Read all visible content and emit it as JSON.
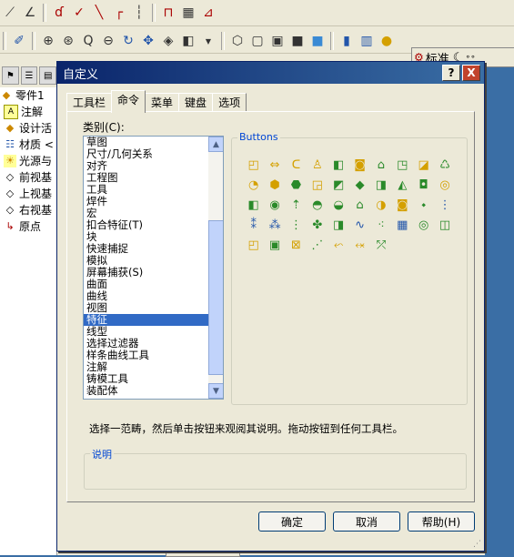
{
  "toolbar_row1": {
    "icons": [
      "sketch-tool",
      "line-tool",
      "arc-tool",
      "check-tool",
      "slash-tool",
      "corner-tool",
      "dashed-corner-tool",
      "dimension-tool",
      "grid-tool",
      "angle-tool"
    ]
  },
  "toolbar_row2": {
    "icons": [
      "pointer-tool",
      "zoom-tool",
      "zoom-fit-tool",
      "zoom-query-tool",
      "zoom-out-tool",
      "rotate-tool",
      "pan-tool",
      "view-tool",
      "view3d-tool",
      "cube-front-view",
      "cube-view-2",
      "cube-view-3",
      "cube-view-4",
      "cube-shaded-view",
      "display-1",
      "display-2",
      "sphere-display"
    ]
  },
  "std_toolbar": {
    "label": "标准"
  },
  "feature_tree": {
    "items": [
      {
        "label": "零件1",
        "icon": "part-icon"
      },
      {
        "label": "注解",
        "icon": "annotation-icon"
      },
      {
        "label": "设计活",
        "icon": "design-icon"
      },
      {
        "label": "材质 <",
        "icon": "material-icon"
      },
      {
        "label": "光源与",
        "icon": "light-icon"
      },
      {
        "label": "前视基",
        "icon": "plane-icon"
      },
      {
        "label": "上视基",
        "icon": "plane-icon"
      },
      {
        "label": "右视基",
        "icon": "plane-icon"
      },
      {
        "label": "原点",
        "icon": "origin-icon"
      }
    ]
  },
  "dialog": {
    "title": "自定义",
    "help_btn": "?",
    "close_btn": "X",
    "tabs": [
      "工具栏",
      "命令",
      "菜单",
      "键盘",
      "选项"
    ],
    "active_tab": "命令",
    "category_label": "类别(C):",
    "categories": [
      "草图",
      "尺寸/几何关系",
      "对齐",
      "工程图",
      "工具",
      "焊件",
      "宏",
      "扣合特征(T)",
      "块",
      "快速捕捉",
      "模拟",
      "屏幕捕获(S)",
      "曲面",
      "曲线",
      "视图",
      "特征",
      "线型",
      "选择过滤器",
      "样条曲线工具",
      "注解",
      "铸模工具",
      "装配体"
    ],
    "selected_category": "特征",
    "buttons_label": "Buttons",
    "help_text": "选择一范畴，然后单击按钮来观阅其说明。拖动按钮到任何工具栏。",
    "description_label": "说明",
    "ok": "确定",
    "cancel": "取消",
    "help": "帮助(H)"
  }
}
